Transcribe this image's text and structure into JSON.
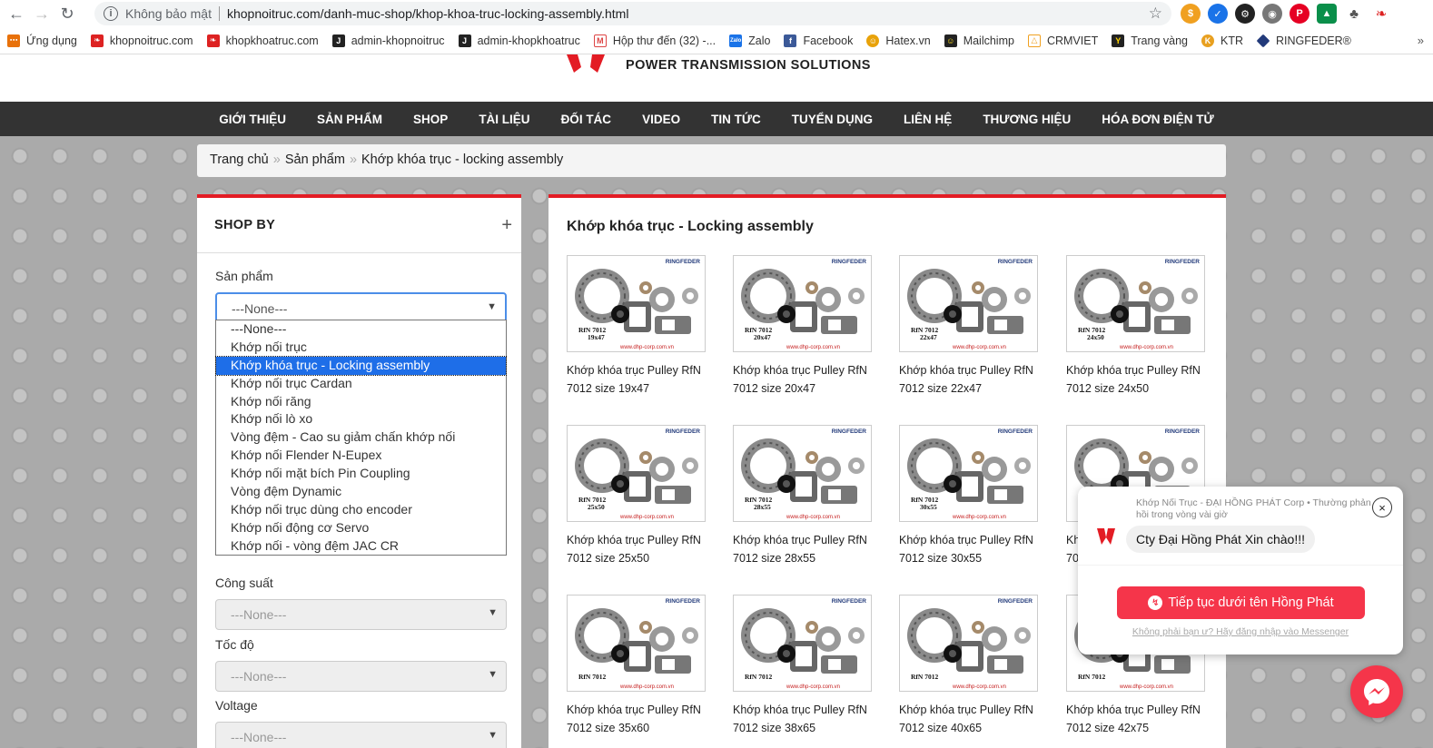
{
  "browser": {
    "insecure_label": "Không bảo mật",
    "url": "khopnoitruc.com/danh-muc-shop/khop-khoa-truc-locking-assembly.html",
    "bookmarks": [
      {
        "label": "Ứng dụng",
        "icon": "apps-grid-icon",
        "color": "#e8710a"
      },
      {
        "label": "khopnoitruc.com",
        "icon": "site-logo-icon",
        "color": "#d22"
      },
      {
        "label": "khopkhoatruc.com",
        "icon": "site-logo-icon",
        "color": "#d22"
      },
      {
        "label": "admin-khopnoitruc",
        "icon": "joomla-icon",
        "color": "#222"
      },
      {
        "label": "admin-khopkhoatruc",
        "icon": "joomla-icon",
        "color": "#222"
      },
      {
        "label": "Hộp thư đến (32) -...",
        "icon": "gmail-icon",
        "color": "#d44"
      },
      {
        "label": "Zalo",
        "icon": "zalo-icon",
        "color": "#1a73e8"
      },
      {
        "label": "Facebook",
        "icon": "facebook-icon",
        "color": "#3b5998"
      },
      {
        "label": "Hatex.vn",
        "icon": "hatex-icon",
        "color": "#e8a20a"
      },
      {
        "label": "Mailchimp",
        "icon": "mailchimp-icon",
        "color": "#222"
      },
      {
        "label": "CRMVIET",
        "icon": "crm-icon",
        "color": "#f0a020"
      },
      {
        "label": "Trang vàng",
        "icon": "yellow-pages-icon",
        "color": "#d8b400"
      },
      {
        "label": "KTR",
        "icon": "ktr-icon",
        "color": "#e8a020"
      },
      {
        "label": "RINGFEDER®",
        "icon": "ringfeder-icon",
        "color": "#223a7a"
      }
    ],
    "more": "»"
  },
  "site": {
    "tagline": "POWER TRANSMISSION SOLUTIONS",
    "nav": [
      "GIỚI THIỆU",
      "SẢN PHẨM",
      "SHOP",
      "TÀI LIỆU",
      "ĐỐI TÁC",
      "VIDEO",
      "TIN TỨC",
      "TUYỂN DỤNG",
      "LIÊN HỆ",
      "THƯƠNG HIỆU",
      "HÓA ĐƠN ĐIỆN TỬ"
    ],
    "breadcrumb": [
      "Trang chủ",
      "Sản phẩm",
      "Khớp khóa trục - locking assembly"
    ]
  },
  "sidebar": {
    "title": "SHOP BY",
    "toggle": "+",
    "product_label": "Sản phẩm",
    "product_value": "---None---",
    "power_label": "Công suất",
    "power_value": "---None---",
    "speed_label": "Tốc độ",
    "speed_value": "---None---",
    "voltage_label": "Voltage",
    "voltage_value": "---None---",
    "options": [
      "---None---",
      "Khớp nối trục",
      "Khớp khóa trục - Locking assembly",
      "Khớp nối trục Cardan",
      "Khớp nối răng",
      "Khớp nối lò xo",
      "Vòng đệm - Cao su giảm chấn khớp nối",
      "Khớp nối Flender N-Eupex",
      "Khớp nối mặt bích Pin Coupling",
      "Vòng đệm Dynamic",
      "Khớp nối trục dùng cho encoder",
      "Khớp nối động cơ Servo",
      "Khớp nối - vòng đệm JAC CR"
    ],
    "selected_index": 2
  },
  "content": {
    "title": "Khớp khóa trục - Locking assembly",
    "products": [
      {
        "line1": "Khớp khóa trục Pulley RfN",
        "line2": "7012 size 19x47",
        "img_size": "19x47"
      },
      {
        "line1": "Khớp khóa trục Pulley RfN",
        "line2": "7012 size 20x47",
        "img_size": "20x47"
      },
      {
        "line1": "Khớp khóa trục Pulley RfN",
        "line2": "7012 size 22x47",
        "img_size": "22x47"
      },
      {
        "line1": "Khớp khóa trục Pulley RfN",
        "line2": "7012 size 24x50",
        "img_size": "24x50"
      },
      {
        "line1": "Khớp khóa trục Pulley RfN",
        "line2": "7012 size 25x50",
        "img_size": "25x50"
      },
      {
        "line1": "Khớp khóa trục Pulley RfN",
        "line2": "7012 size 28x55",
        "img_size": "28x55"
      },
      {
        "line1": "Khớp khóa trục Pulley RfN",
        "line2": "7012 size 30x55",
        "img_size": "30x55"
      },
      {
        "line1": "Kh",
        "line2": "70",
        "img_size": ""
      },
      {
        "line1": "Khớp khóa trục Pulley RfN",
        "line2": "7012 size 35x60",
        "img_size": ""
      },
      {
        "line1": "Khớp khóa trục Pulley RfN",
        "line2": "7012 size 38x65",
        "img_size": ""
      },
      {
        "line1": "Khớp khóa trục Pulley RfN",
        "line2": "7012 size 40x65",
        "img_size": ""
      },
      {
        "line1": "Khớp khóa trục Pulley RfN",
        "line2": "7012 size 42x75",
        "img_size": ""
      }
    ],
    "img_brand": "RINGFEDER",
    "img_model": "RfN 7012",
    "img_web": "www.dhp-corp.com.vn"
  },
  "messenger": {
    "header": "Khớp Nối Trục - ĐẠI HỒNG PHÁT Corp • Thường phản hồi trong vòng vài giờ",
    "greeting": "Cty Đại Hồng Phát Xin chào!!!",
    "cta": "Tiếp tục dưới tên Hồng Phát",
    "login": "Không phải bạn ư? Hãy đăng nhập vào Messenger",
    "close": "×"
  },
  "colors": {
    "accent": "#e31c24",
    "nav_bg": "#333333",
    "messenger": "#f5354a",
    "select_highlight": "#1e6ee8"
  }
}
